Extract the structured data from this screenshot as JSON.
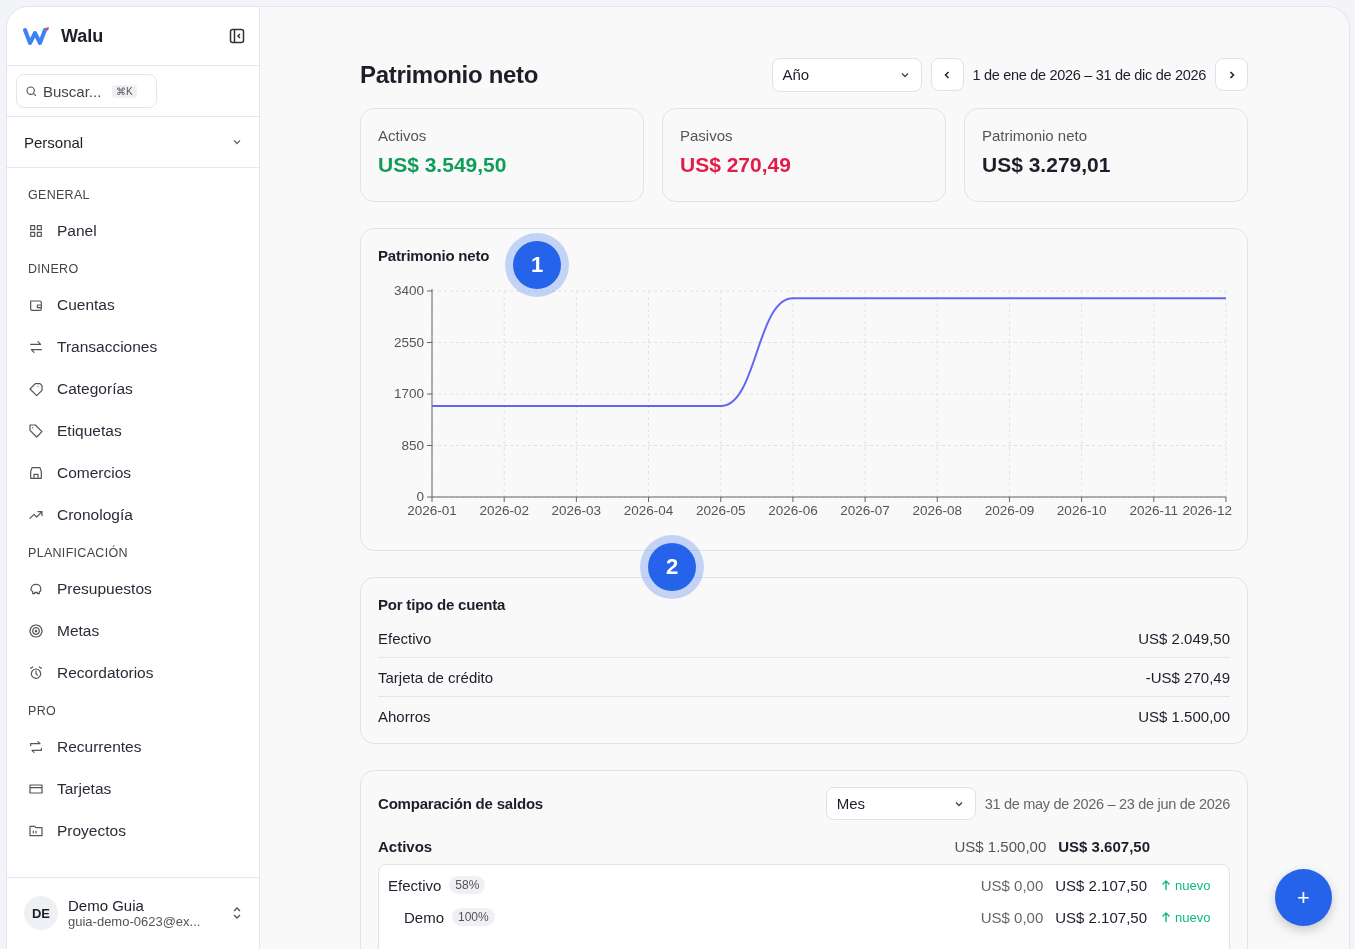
{
  "sidebar": {
    "brand": "Walu",
    "search": {
      "placeholder": "Buscar...",
      "shortcut": "⌘K"
    },
    "workspace": "Personal",
    "sections": [
      {
        "title": "GENERAL",
        "items": [
          {
            "label": "Panel"
          }
        ]
      },
      {
        "title": "DINERO",
        "items": [
          {
            "label": "Cuentas"
          },
          {
            "label": "Transacciones"
          },
          {
            "label": "Categorías"
          },
          {
            "label": "Etiquetas"
          },
          {
            "label": "Comercios"
          },
          {
            "label": "Cronología"
          }
        ]
      },
      {
        "title": "PLANIFICACIÓN",
        "items": [
          {
            "label": "Presupuestos"
          },
          {
            "label": "Metas"
          },
          {
            "label": "Recordatorios"
          }
        ]
      },
      {
        "title": "PRO",
        "items": [
          {
            "label": "Recurrentes"
          },
          {
            "label": "Tarjetas"
          },
          {
            "label": "Proyectos"
          }
        ]
      }
    ],
    "user": {
      "initials": "DE",
      "name": "Demo Guia",
      "email": "guia-demo-0623@ex..."
    }
  },
  "header": {
    "title": "Patrimonio neto",
    "period": "Año",
    "range": "1 de ene de 2026 – 31 de dic de 2026"
  },
  "summary": [
    {
      "label": "Activos",
      "value": "US$ 3.549,50",
      "color": "#0f9d58"
    },
    {
      "label": "Pasivos",
      "value": "US$ 270,49",
      "color": "#e11d48"
    },
    {
      "label": "Patrimonio neto",
      "value": "US$ 3.279,01",
      "color": "#1c1f2a"
    }
  ],
  "chart": {
    "title": "Patrimonio neto",
    "chart_data": {
      "type": "line",
      "categories": [
        "2026-01",
        "2026-02",
        "2026-03",
        "2026-04",
        "2026-05",
        "2026-06",
        "2026-07",
        "2026-08",
        "2026-09",
        "2026-10",
        "2026-11",
        "2026-12"
      ],
      "series": [
        {
          "color": "#6366f1",
          "values": [
            1500,
            1500,
            1500,
            1500,
            1500,
            3280,
            3280,
            3280,
            3280,
            3280,
            3280,
            3280
          ]
        }
      ],
      "ylim": [
        0,
        3400
      ],
      "yticks": [
        0,
        850,
        1700,
        2550,
        3400
      ],
      "grid": true
    }
  },
  "account_types": {
    "title": "Por tipo de cuenta",
    "rows": [
      {
        "name": "Efectivo",
        "amount": "US$ 2.049,50"
      },
      {
        "name": "Tarjeta de crédito",
        "amount": "-US$ 270,49"
      },
      {
        "name": "Ahorros",
        "amount": "US$ 1.500,00"
      }
    ]
  },
  "comparison": {
    "title": "Comparación de saldos",
    "period": "Mes",
    "range": "31 de may de 2026 – 23 de jun de 2026",
    "groups": [
      {
        "name": "Activos",
        "before": "US$ 1.500,00",
        "after": "US$ 3.607,50",
        "rows": [
          {
            "name": "Efectivo",
            "share": "58%",
            "before": "US$ 0,00",
            "after": "US$ 2.107,50",
            "trend": "nuevo",
            "children": [
              {
                "name": "Demo",
                "share": "100%",
                "before": "US$ 0,00",
                "after": "US$ 2.107,50",
                "trend": "nuevo"
              }
            ]
          }
        ]
      }
    ]
  },
  "markers": [
    {
      "label": "1"
    },
    {
      "label": "2"
    }
  ],
  "fab": "+"
}
